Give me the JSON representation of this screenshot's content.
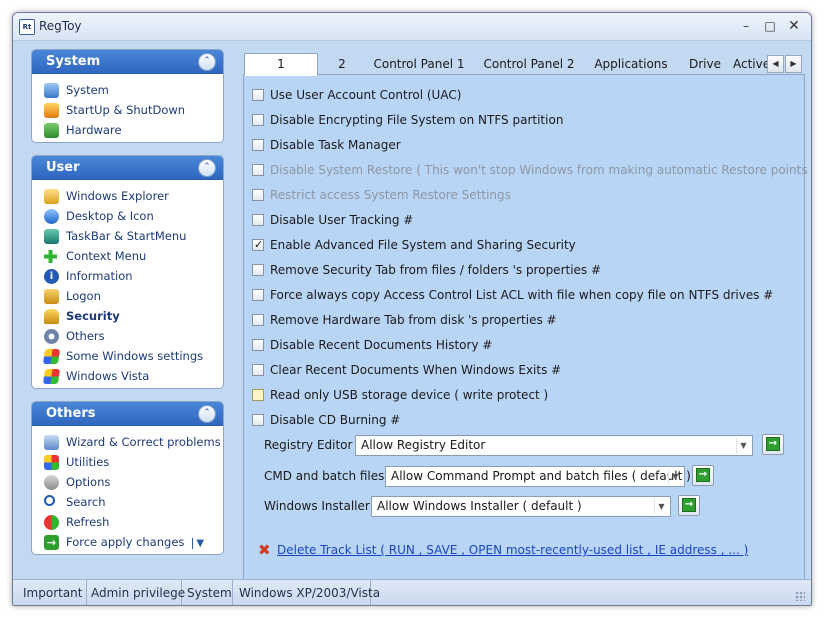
{
  "window": {
    "title": "RegToy",
    "app_icon": "Rt"
  },
  "sidebar": {
    "system": {
      "title": "System",
      "items": [
        {
          "label": "System",
          "icon": "computer-icon"
        },
        {
          "label": "StartUp & ShutDown",
          "icon": "startup-icon"
        },
        {
          "label": "Hardware",
          "icon": "hardware-icon"
        }
      ]
    },
    "user": {
      "title": "User",
      "items": [
        {
          "label": "Windows Explorer",
          "icon": "folder-icon"
        },
        {
          "label": "Desktop & Icon",
          "icon": "desktop-icon"
        },
        {
          "label": "TaskBar & StartMenu",
          "icon": "taskbar-icon"
        },
        {
          "label": "Context Menu",
          "icon": "plus-icon"
        },
        {
          "label": "Information",
          "icon": "info-icon"
        },
        {
          "label": "Logon",
          "icon": "key-icon"
        },
        {
          "label": "Security",
          "icon": "lock-icon",
          "active": true
        },
        {
          "label": "Others",
          "icon": "gear-icon"
        },
        {
          "label": "Some Windows settings",
          "icon": "windows-flag-icon"
        },
        {
          "label": "Windows Vista",
          "icon": "windows-flag-icon"
        }
      ]
    },
    "others": {
      "title": "Others",
      "items": [
        {
          "label": "Wizard & Correct problems",
          "icon": "wizard-icon"
        },
        {
          "label": "Utilities",
          "icon": "utilities-icon"
        },
        {
          "label": "Options",
          "icon": "options-icon"
        },
        {
          "label": "Search",
          "icon": "search-icon"
        },
        {
          "label": "Refresh",
          "icon": "refresh-icon"
        },
        {
          "label": "Force apply changes",
          "icon": "apply-arrow-icon"
        }
      ]
    }
  },
  "tabs": [
    "1",
    "2",
    "Control Panel 1",
    "Control Panel 2",
    "Applications",
    "Drive",
    "Active"
  ],
  "active_tab": "1",
  "options": [
    {
      "label": "Use User Account Control (UAC)",
      "checked": false,
      "disabled": false
    },
    {
      "label": "Disable Encrypting File System on NTFS partition",
      "checked": false,
      "disabled": false
    },
    {
      "label": "Disable Task Manager",
      "checked": false,
      "disabled": false
    },
    {
      "label": "Disable System Restore ( This won't stop Windows from making automatic Restore points )",
      "checked": false,
      "disabled": true
    },
    {
      "label": "Restrict access System Restore Settings",
      "checked": false,
      "disabled": true
    },
    {
      "label": "Disable User Tracking #",
      "checked": false,
      "disabled": false
    },
    {
      "label": "Enable Advanced File System and Sharing Security",
      "checked": true,
      "disabled": false
    },
    {
      "label": "Remove Security Tab from files / folders 's properties #",
      "checked": false,
      "disabled": false
    },
    {
      "label": "Force always copy Access Control List ACL with file when copy file on NTFS drives #",
      "checked": false,
      "disabled": false
    },
    {
      "label": "Remove Hardware Tab from disk 's properties #",
      "checked": false,
      "disabled": false
    },
    {
      "label": "Disable Recent Documents History #",
      "checked": false,
      "disabled": false
    },
    {
      "label": "Clear Recent Documents When Windows Exits #",
      "checked": false,
      "disabled": false
    },
    {
      "label": "Read only USB storage device ( write protect )",
      "checked": false,
      "disabled": false,
      "highlight": true
    },
    {
      "label": "Disable CD Burning #",
      "checked": false,
      "disabled": false
    }
  ],
  "selects": {
    "registry_editor": {
      "label": "Registry Editor",
      "value": "Allow Registry Editor"
    },
    "cmd_batch": {
      "label": "CMD and batch files",
      "value": "Allow Command Prompt and batch files ( default )"
    },
    "windows_installer": {
      "label": "Windows Installer",
      "value": "Allow Windows Installer ( default )"
    }
  },
  "track_link": "Delete Track List ( RUN , SAVE , OPEN most-recently-used list , IE address , ... )",
  "statusbar": [
    "Important",
    "Admin privilege",
    "System",
    "Windows XP/2003/Vista"
  ],
  "colors": {
    "panel_header": "#2f66c0",
    "tab_page": "#b9d5f6",
    "link": "#1a44c4",
    "apply_green": "#2e9e2e"
  }
}
